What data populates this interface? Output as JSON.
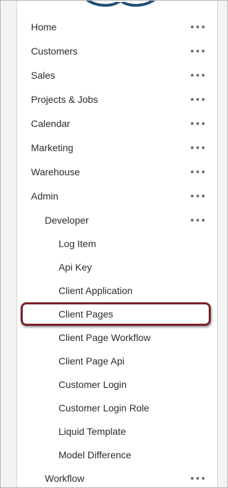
{
  "nav": {
    "home": "Home",
    "customers": "Customers",
    "sales": "Sales",
    "projects_jobs": "Projects & Jobs",
    "calendar": "Calendar",
    "marketing": "Marketing",
    "warehouse": "Warehouse",
    "admin": "Admin",
    "developer": "Developer",
    "log_item": "Log Item",
    "api_key": "Api Key",
    "client_application": "Client Application",
    "client_pages": "Client Pages",
    "client_page_workflow": "Client Page Workflow",
    "client_page_api": "Client Page Api",
    "customer_login": "Customer Login",
    "customer_login_role": "Customer Login Role",
    "liquid_template": "Liquid Template",
    "model_difference": "Model Difference",
    "workflow": "Workflow"
  },
  "icons": {
    "menu": "more-horizontal-icon",
    "logo": "cloud-logo"
  },
  "colors": {
    "highlight": "#7a1f26",
    "logo": "#1f4e79"
  }
}
